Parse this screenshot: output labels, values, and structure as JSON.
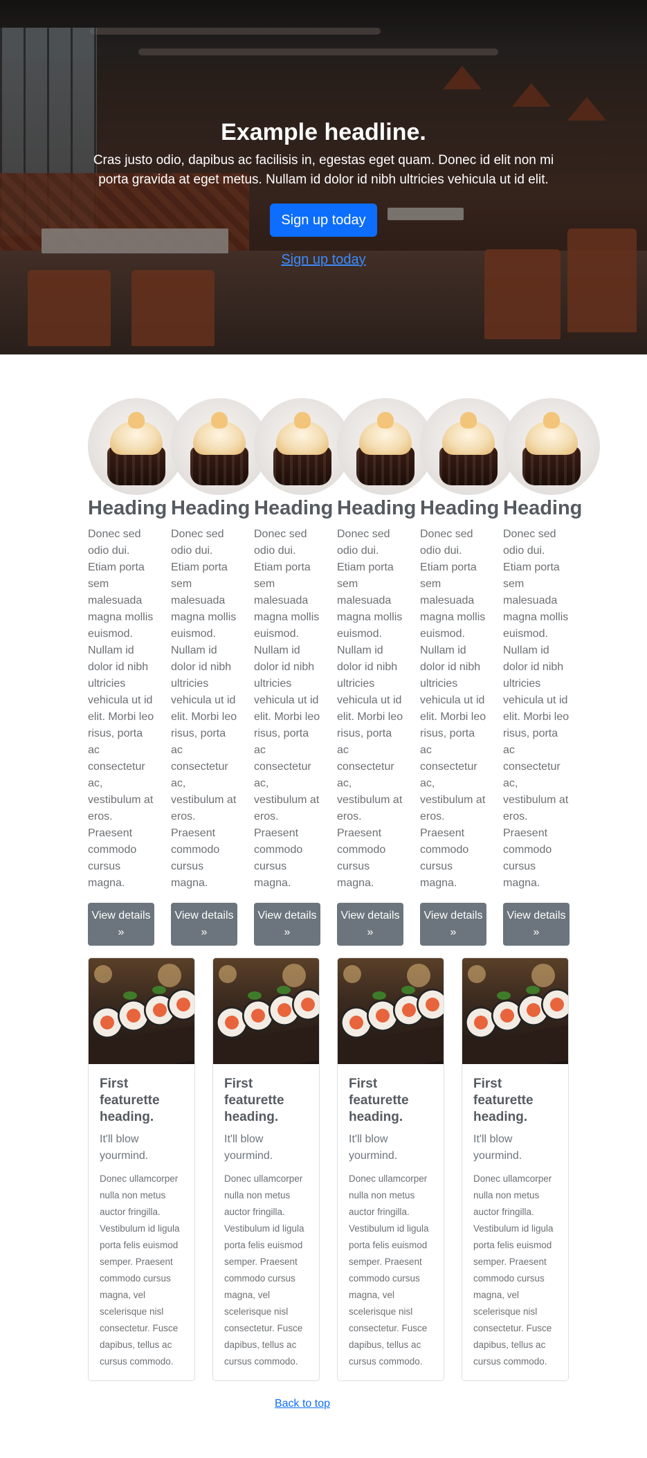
{
  "hero": {
    "title": "Example headline.",
    "text": "Cras justo odio, dapibus ac facilisis in, egestas eget quam. Donec id elit non mi porta gravida at eget metus. Nullam id dolor id nibh ultricies vehicula ut id elit.",
    "primary_button": "Sign up today",
    "secondary_link": "Sign up today"
  },
  "columns": [
    {
      "heading": "Heading",
      "text": "Donec sed odio dui. Etiam porta sem malesuada magna mollis euismod. Nullam id dolor id nibh ultricies vehicula ut id elit. Morbi leo risus, porta ac consectetur ac, vestibulum at eros. Praesent commodo cursus magna.",
      "button": "View details »"
    },
    {
      "heading": "Heading",
      "text": "Donec sed odio dui. Etiam porta sem malesuada magna mollis euismod. Nullam id dolor id nibh ultricies vehicula ut id elit. Morbi leo risus, porta ac consectetur ac, vestibulum at eros. Praesent commodo cursus magna.",
      "button": "View details »"
    },
    {
      "heading": "Heading",
      "text": "Donec sed odio dui. Etiam porta sem malesuada magna mollis euismod. Nullam id dolor id nibh ultricies vehicula ut id elit. Morbi leo risus, porta ac consectetur ac, vestibulum at eros. Praesent commodo cursus magna.",
      "button": "View details »"
    },
    {
      "heading": "Heading",
      "text": "Donec sed odio dui. Etiam porta sem malesuada magna mollis euismod. Nullam id dolor id nibh ultricies vehicula ut id elit. Morbi leo risus, porta ac consectetur ac, vestibulum at eros. Praesent commodo cursus magna.",
      "button": "View details »"
    },
    {
      "heading": "Heading",
      "text": "Donec sed odio dui. Etiam porta sem malesuada magna mollis euismod. Nullam id dolor id nibh ultricies vehicula ut id elit. Morbi leo risus, porta ac consectetur ac, vestibulum at eros. Praesent commodo cursus magna.",
      "button": "View details »"
    },
    {
      "heading": "Heading",
      "text": "Donec sed odio dui. Etiam porta sem malesuada magna mollis euismod. Nullam id dolor id nibh ultricies vehicula ut id elit. Morbi leo risus, porta ac consectetur ac, vestibulum at eros. Praesent commodo cursus magna.",
      "button": "View details »"
    }
  ],
  "cards": [
    {
      "title": "First featurette heading.",
      "subtitle": "It'll blow yourmind.",
      "text": "Donec ullamcorper nulla non metus auctor fringilla. Vestibulum id ligula porta felis euismod semper. Praesent commodo cursus magna, vel scelerisque nisl consectetur. Fusce dapibus, tellus ac cursus commodo."
    },
    {
      "title": "First featurette heading.",
      "subtitle": "It'll blow yourmind.",
      "text": "Donec ullamcorper nulla non metus auctor fringilla. Vestibulum id ligula porta felis euismod semper. Praesent commodo cursus magna, vel scelerisque nisl consectetur. Fusce dapibus, tellus ac cursus commodo."
    },
    {
      "title": "First featurette heading.",
      "subtitle": "It'll blow yourmind.",
      "text": "Donec ullamcorper nulla non metus auctor fringilla. Vestibulum id ligula porta felis euismod semper. Praesent commodo cursus magna, vel scelerisque nisl consectetur. Fusce dapibus, tellus ac cursus commodo."
    },
    {
      "title": "First featurette heading.",
      "subtitle": "It'll blow yourmind.",
      "text": "Donec ullamcorper nulla non metus auctor fringilla. Vestibulum id ligula porta felis euismod semper. Praesent commodo cursus magna, vel scelerisque nisl consectetur. Fusce dapibus, tellus ac cursus commodo."
    }
  ],
  "footer": {
    "back_to_top": "Back to top"
  },
  "colors": {
    "primary": "#0d6efd",
    "secondary": "#6c757d"
  }
}
